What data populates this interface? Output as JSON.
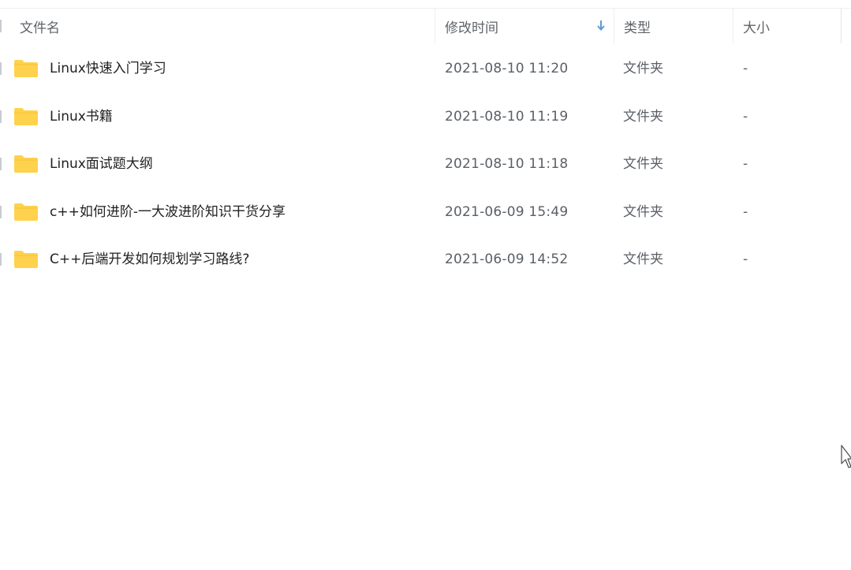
{
  "header": {
    "name_label": "文件名",
    "mtime_label": "修改时间",
    "type_label": "类型",
    "size_label": "大小",
    "sort_icon": "arrow-down-icon",
    "sort_color": "#5b9bd5"
  },
  "folder_color": "#ffd24d",
  "files": [
    {
      "name": "Linux快速入门学习",
      "mtime": "2021-08-10 11:20",
      "type": "文件夹",
      "size": "-"
    },
    {
      "name": "Linux书籍",
      "mtime": "2021-08-10 11:19",
      "type": "文件夹",
      "size": "-"
    },
    {
      "name": "Linux面试题大纲",
      "mtime": "2021-08-10 11:18",
      "type": "文件夹",
      "size": "-"
    },
    {
      "name": "c++如何进阶-一大波进阶知识干货分享",
      "mtime": "2021-06-09 15:49",
      "type": "文件夹",
      "size": "-"
    },
    {
      "name": "C++后端开发如何规划学习路线?",
      "mtime": "2021-06-09 14:52",
      "type": "文件夹",
      "size": "-"
    }
  ]
}
